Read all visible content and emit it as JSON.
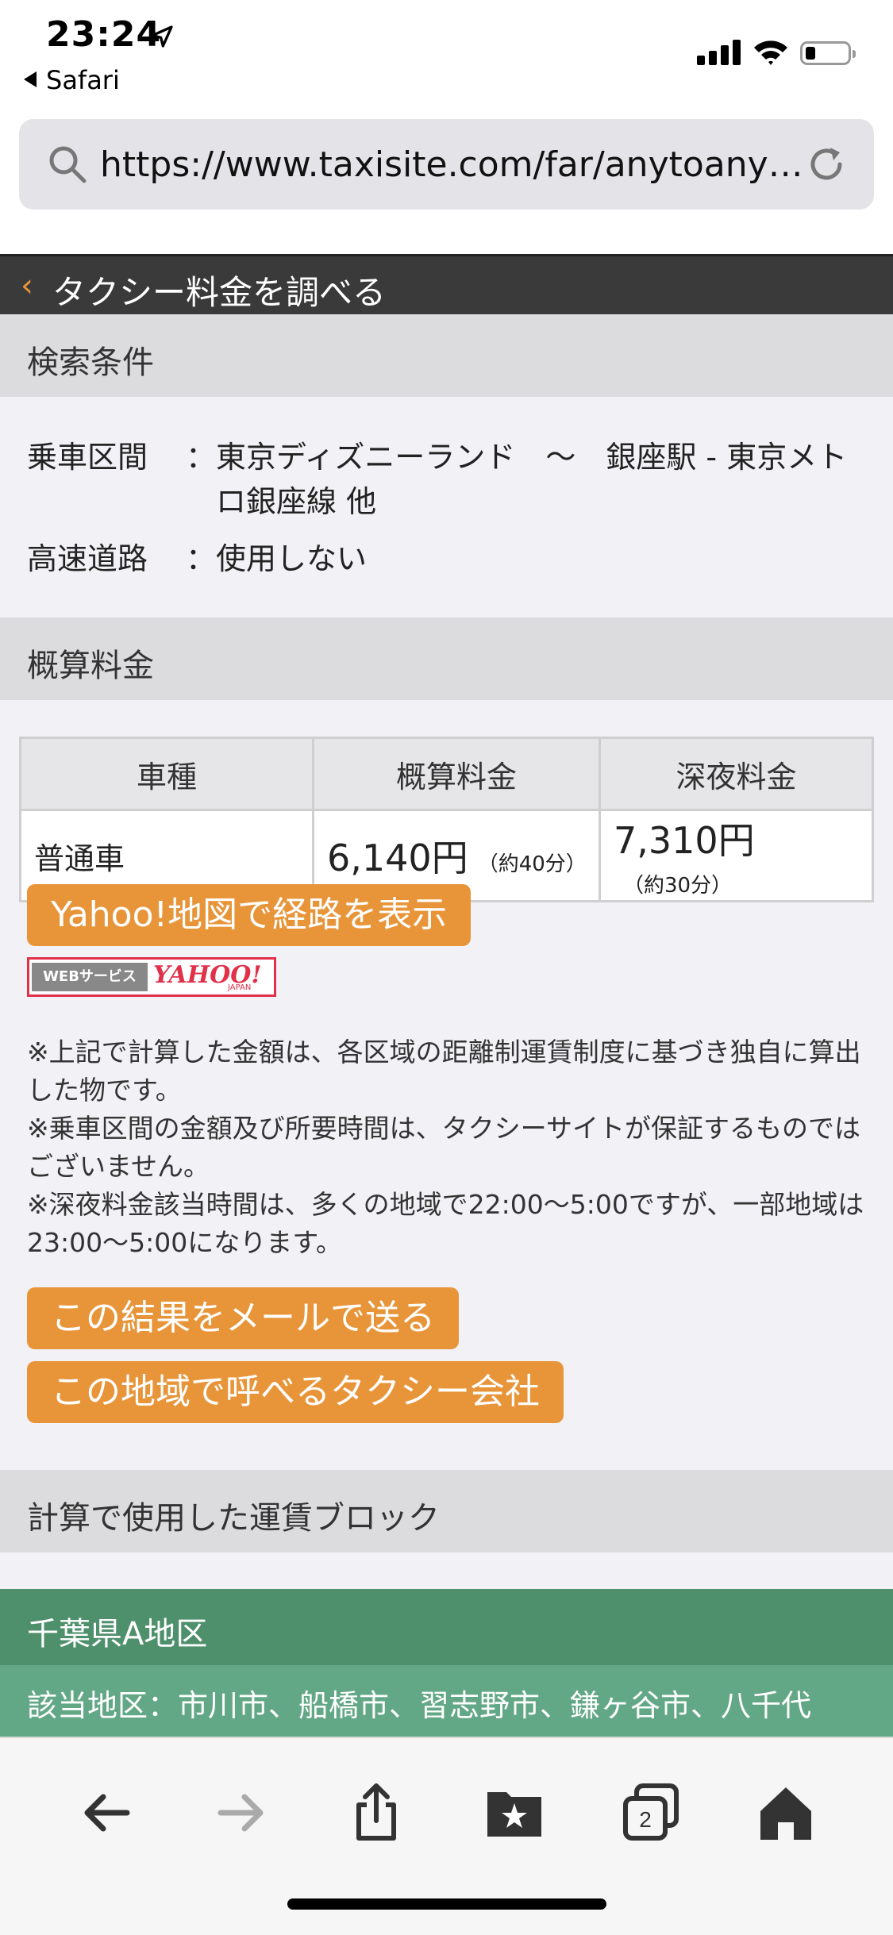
{
  "status": {
    "time": "23:24",
    "back_app": "Safari"
  },
  "browser": {
    "url": "https://www.taxisite.com/far/anytoanyret…"
  },
  "header": {
    "title": "タクシー料金を調べる"
  },
  "search_conditions": {
    "heading": "検索条件",
    "route_label": "乗車区間",
    "route_value": "東京ディズニーランド　〜　銀座駅 - 東京メトロ銀座線 他",
    "highway_label": "高速道路",
    "highway_value": "使用しない",
    "colon": "："
  },
  "estimate": {
    "heading": "概算料金",
    "columns": [
      "車種",
      "概算料金",
      "深夜料金"
    ],
    "rows": [
      {
        "type": "普通車",
        "fare": "6,140円",
        "fare_time": "（約40分）",
        "night_fare": "7,310円",
        "night_time": "（約30分）"
      }
    ]
  },
  "yahoo_button": "Yahoo!地図で経路を表示",
  "yahoo_logo": {
    "left": "WEBサービス",
    "right": "YAHOO!",
    "sub": "JAPAN"
  },
  "notes": [
    "※上記で計算した金額は、各区域の距離制運賃制度に基づき独自に算出した物です。",
    "※乗車区間の金額及び所要時間は、タクシーサイトが保証するものではございません。",
    "※深夜料金該当時間は、多くの地域で22:00〜5:00ですが、一部地域は23:00〜5:00になります。"
  ],
  "actions": {
    "mail_button": "この結果をメールで送る",
    "companies_button": "この地域で呼べるタクシー会社"
  },
  "fare_blocks": {
    "heading": "計算で使用した運賃ブロック",
    "area_name": "千葉県A地区",
    "area_detail": "該当地区：市川市、船橋市、習志野市、鎌ヶ谷市、八千代"
  },
  "colors": {
    "accent": "#e8953a",
    "area_green": "#4e8f6c",
    "area_green_light": "#63a886"
  },
  "toolbar_icons": [
    "back-icon",
    "forward-icon",
    "share-icon",
    "bookmarks-icon",
    "tabs-icon",
    "home-icon"
  ],
  "toolbar": {
    "tabs_count": "2"
  }
}
